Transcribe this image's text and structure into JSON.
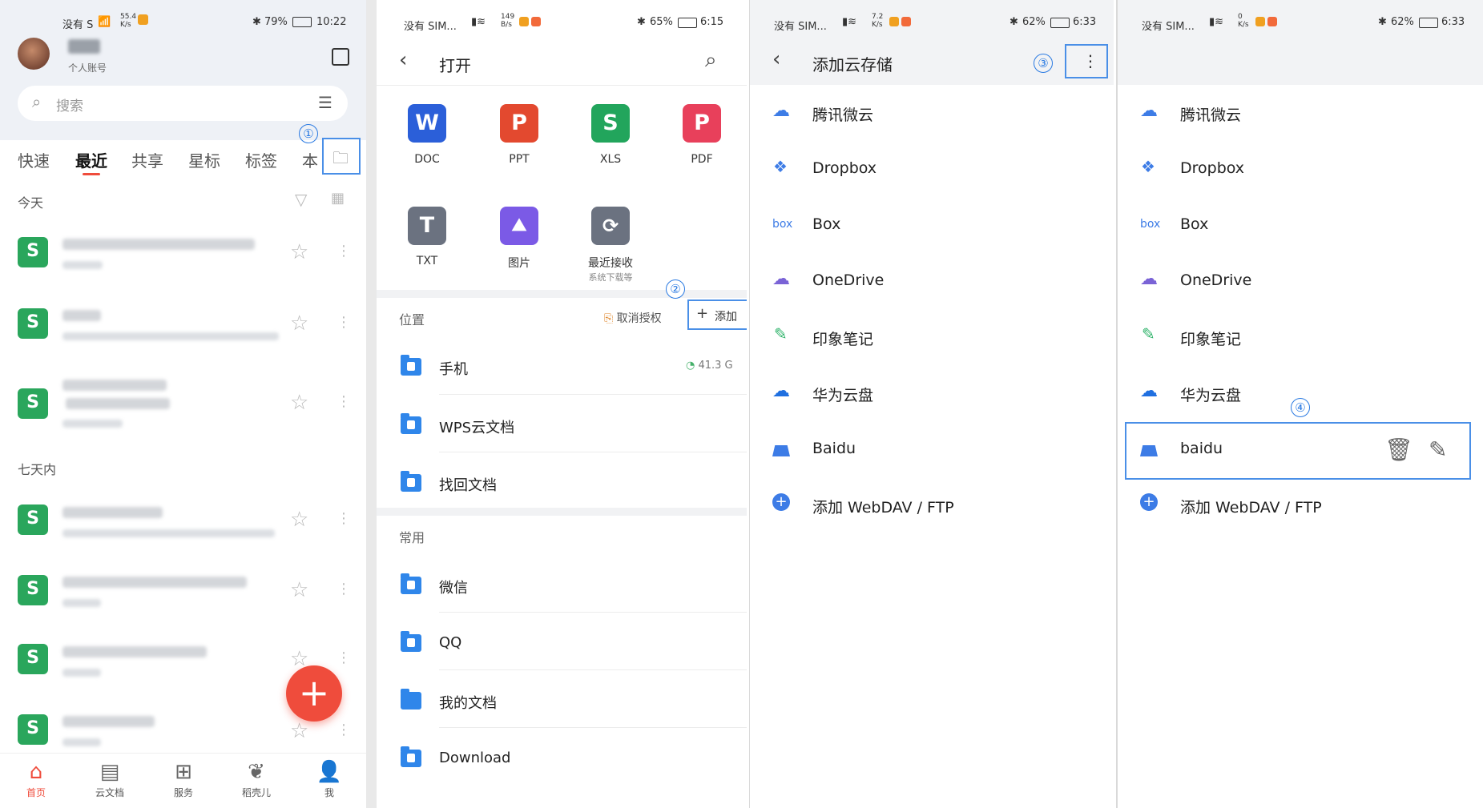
{
  "colors": {
    "accent": "#2a7ae2",
    "red": "#ef4c3c",
    "green": "#2aa65c",
    "folder_blue": "#2f86ea"
  },
  "panel1": {
    "status": {
      "carrier": "没有 S",
      "speed_top": "55.4",
      "speed_bottom": "K/s",
      "battery": "79%",
      "time": "10:22"
    },
    "account": {
      "subtitle": "个人账号"
    },
    "search": {
      "placeholder": "搜索"
    },
    "tabs": [
      "快速",
      "最近",
      "共享",
      "星标",
      "标签",
      "本"
    ],
    "callout": "①",
    "section_today": "今天",
    "section_week": "七天内",
    "file_badge": "S",
    "nav": [
      "首页",
      "云文档",
      "服务",
      "稻壳儿",
      "我"
    ],
    "fab": "+"
  },
  "panel2": {
    "status": {
      "carrier": "没有 SIM...",
      "speed_top": "149",
      "speed_bottom": "B/s",
      "battery": "65%",
      "time": "6:15"
    },
    "title": "打开",
    "apps": [
      {
        "glyph": "W",
        "label": "DOC"
      },
      {
        "glyph": "P",
        "label": "PPT"
      },
      {
        "glyph": "S",
        "label": "XLS"
      },
      {
        "glyph": "P",
        "label": "PDF"
      },
      {
        "glyph": "T",
        "label": "TXT"
      },
      {
        "glyph": "⛰",
        "label": "图片"
      },
      {
        "glyph": "⟳",
        "label": "最近接收",
        "sub": "系统下载等"
      }
    ],
    "location_header": "位置",
    "revoke": "取消授权",
    "add": "添加",
    "callout": "②",
    "locations": [
      {
        "name": "手机",
        "size": "41.3 G"
      },
      {
        "name": "WPS云文档"
      },
      {
        "name": "找回文档"
      }
    ],
    "common_header": "常用",
    "common": [
      "微信",
      "QQ",
      "我的文档",
      "Download"
    ]
  },
  "panel3": {
    "status": {
      "carrier": "没有 SIM...",
      "speed_top": "7.2",
      "speed_bottom": "K/s",
      "battery": "62%",
      "time": "6:33"
    },
    "title": "添加云存储",
    "callout": "③",
    "items": [
      "腾讯微云",
      "Dropbox",
      "Box",
      "OneDrive",
      "印象笔记",
      "华为云盘",
      "Baidu",
      "添加 WebDAV / FTP"
    ]
  },
  "panel4": {
    "status": {
      "carrier": "没有 SIM...",
      "speed_top": "0",
      "speed_bottom": "K/s",
      "battery": "62%",
      "time": "6:33"
    },
    "callout": "④",
    "items": [
      "腾讯微云",
      "Dropbox",
      "Box",
      "OneDrive",
      "印象笔记",
      "华为云盘",
      "baidu",
      "添加 WebDAV / FTP"
    ]
  }
}
